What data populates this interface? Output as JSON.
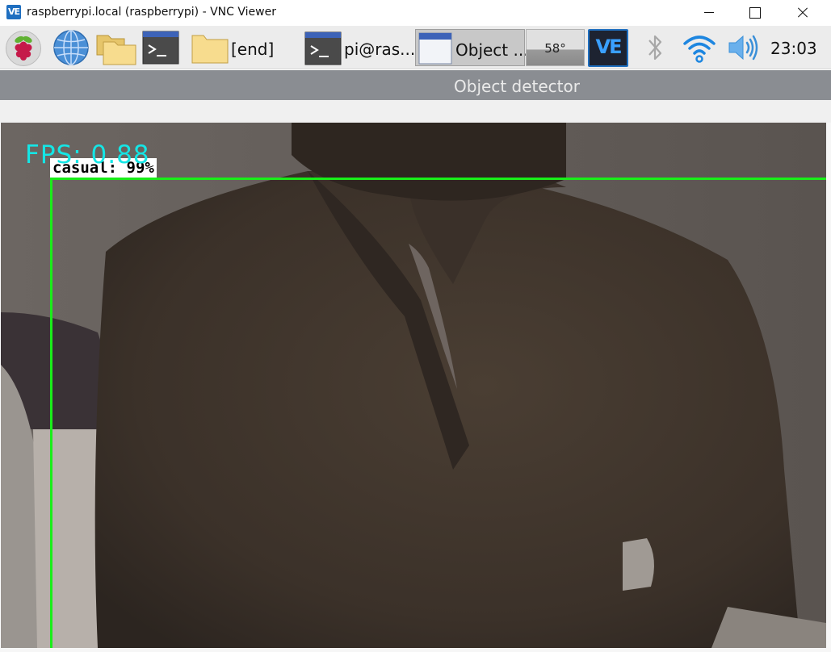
{
  "window": {
    "title": "raspberrypi.local (raspberrypi) - VNC Viewer",
    "app_icon_text": "VE"
  },
  "taskbar": {
    "tasks": [
      {
        "label": "[end]",
        "icon": "folder-icon"
      },
      {
        "label": "pi@ras...",
        "icon": "terminal-icon"
      },
      {
        "label": "Object ...",
        "icon": "window-icon"
      }
    ],
    "temperature": "58°",
    "vnc_tray_text": "VE",
    "clock": "23:03",
    "launchers": [
      "raspberry-pi-menu-icon",
      "globe-browser-icon",
      "file-manager-icon",
      "terminal-icon"
    ],
    "tray_icons": [
      "bluetooth-icon",
      "wifi-icon",
      "volume-icon"
    ]
  },
  "app": {
    "title": "Object detector"
  },
  "camera": {
    "fps_text": "FPS: 0.88",
    "detection_label": "casual: 99%",
    "box_color": "#19ee19",
    "fps_color": "#14e6e6"
  }
}
